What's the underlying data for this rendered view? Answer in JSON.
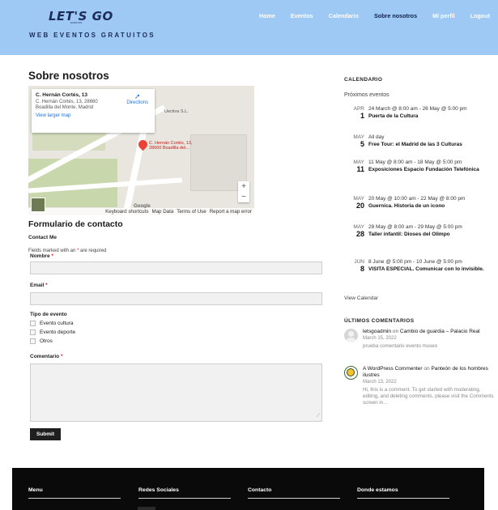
{
  "header": {
    "logo": "LET'S GO",
    "logo_sub": "EVENTOS",
    "tagline": "WEB EVENTOS GRATUITOS",
    "nav": [
      "Home",
      "Eventos",
      "Calendario",
      "Sobre nosotros",
      "Mi perfil",
      "Logout"
    ],
    "active_nav": "Sobre nosotros",
    "bg_color": "#9ec9f5"
  },
  "main": {
    "title": "Sobre nosotros",
    "map": {
      "card_title": "C. Hernán Cortés, 13",
      "card_address": "C. Hernán Cortés, 13, 28660 Boadilla del Monte, Madrid",
      "directions": "Directions",
      "view_larger": "View larger map",
      "pin_label": "C. Hernán Cortés, 13, 28660 Boadilla del...",
      "place_label": "Uectiva S.L.",
      "footer_links": [
        "Keyboard shortcuts",
        "Map Data",
        "Terms of Use",
        "Report a map error"
      ],
      "google": "Google"
    },
    "form": {
      "title": "Formulario de contacto",
      "subtitle": "Contact Me",
      "required_note": "Fields marked with an",
      "required_note_tail": "are required",
      "name_label": "Nombre",
      "email_label": "Email",
      "type_label": "Tipo de evento",
      "options": [
        "Evento cultura",
        "Evento deporte",
        "Otros"
      ],
      "comment_label": "Comentario",
      "submit": "Submit"
    }
  },
  "sidebar": {
    "calendar_title": "CALENDARIO",
    "calendar_sub": "Próximos eventos",
    "events": [
      {
        "month": "APR",
        "day": "1",
        "time": "24 March @ 8:00 am - 26 May @ 5:00 pm",
        "name": "Puerta de la Cultura"
      },
      {
        "month": "MAY",
        "day": "5",
        "time": "All day",
        "name": "Free Tour: el Madrid de las 3 Culturas"
      },
      {
        "month": "MAY",
        "day": "11",
        "time": "11 May @ 8:00 am - 18 May @ 5:00 pm",
        "name": "Exposiciones Espacio Fundación Telefónica"
      },
      {
        "month": "MAY",
        "day": "20",
        "time": "20 May @ 10:00 am - 22 May @ 8:00 pm",
        "name": "Guernica. Historia de un icono"
      },
      {
        "month": "MAY",
        "day": "28",
        "time": "28 May @ 8:00 am - 29 May @ 5:00 pm",
        "name": "Taller infantil: Dioses del Olimpo"
      },
      {
        "month": "JUN",
        "day": "8",
        "time": "8 June @ 5:00 pm - 10 June @ 5:00 pm",
        "name": "VISITA ESPECIAL. Comunicar con lo invisible."
      }
    ],
    "view_calendar": "View Calendar",
    "comments_title": "ÚLTIMOS COMENTARIOS",
    "comments": [
      {
        "author": "letsgoadmin",
        "on": "on",
        "post": "Cambio de guardia – Palacio Real",
        "date": "March 15, 2022",
        "text": "prueba comentario evento museo"
      },
      {
        "author": "A WordPress Commenter",
        "on": "on",
        "post": "Panteón de los hombres ilustres",
        "date": "March 13, 2022",
        "text": "Hi, this is a comment. To get started with moderating, editing, and deleting comments, please visit the Comments screen in…"
      }
    ]
  },
  "footer": {
    "columns": [
      "Menu",
      "Redes Sociales",
      "Contacto",
      "Donde estamos"
    ]
  }
}
